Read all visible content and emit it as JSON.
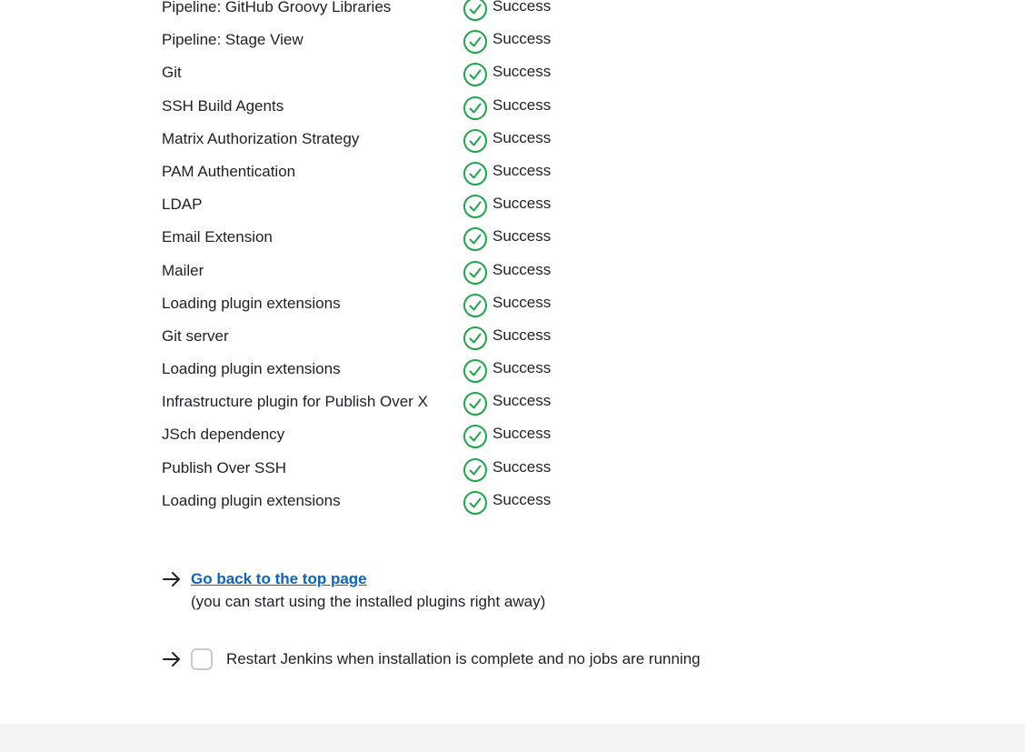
{
  "plugins": [
    {
      "name": "Pipeline: GitHub Groovy Libraries",
      "status": "Success"
    },
    {
      "name": "Pipeline: Stage View",
      "status": "Success"
    },
    {
      "name": "Git",
      "status": "Success"
    },
    {
      "name": "SSH Build Agents",
      "status": "Success"
    },
    {
      "name": "Matrix Authorization Strategy",
      "status": "Success"
    },
    {
      "name": "PAM Authentication",
      "status": "Success"
    },
    {
      "name": "LDAP",
      "status": "Success"
    },
    {
      "name": "Email Extension",
      "status": "Success"
    },
    {
      "name": "Mailer",
      "status": "Success"
    },
    {
      "name": "Loading plugin extensions",
      "status": "Success"
    },
    {
      "name": "Git server",
      "status": "Success"
    },
    {
      "name": "Loading plugin extensions",
      "status": "Success"
    },
    {
      "name": "Infrastructure plugin for Publish Over X",
      "status": "Success"
    },
    {
      "name": "JSch dependency",
      "status": "Success"
    },
    {
      "name": "Publish Over SSH",
      "status": "Success"
    },
    {
      "name": "Loading plugin extensions",
      "status": "Success"
    }
  ],
  "status_icon": "check-circle-icon",
  "colors": {
    "success": "#1ea64a",
    "link": "#0b63c6",
    "text": "#1f1f28",
    "footer_bg": "#f4f4f6"
  },
  "actions": {
    "top_page_link": "Go back to the top page",
    "top_page_hint": "(you can start using the installed plugins right away)",
    "restart_label": "Restart Jenkins when installation is complete and no jobs are running",
    "restart_checked": false
  }
}
